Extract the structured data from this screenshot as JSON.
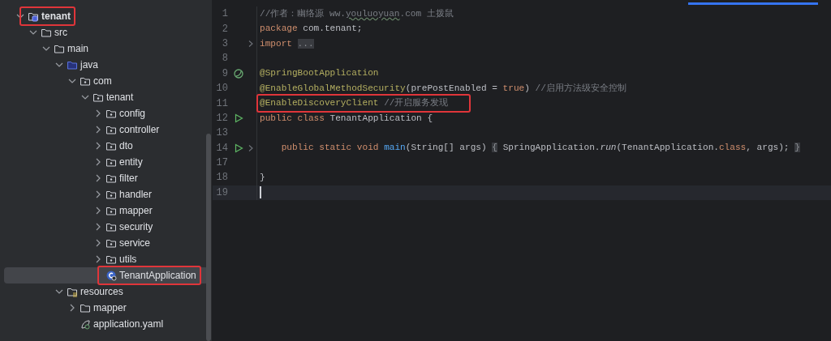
{
  "project_tree": {
    "items": [
      {
        "label": "tenant",
        "kind": "module",
        "expanded": true,
        "selected": false,
        "highlighted": true,
        "children": [
          {
            "label": "src",
            "kind": "folder",
            "expanded": true,
            "selected": false,
            "highlighted": false,
            "children": [
              {
                "label": "main",
                "kind": "folder",
                "expanded": true,
                "selected": false,
                "highlighted": false,
                "children": [
                  {
                    "label": "java",
                    "kind": "source-folder",
                    "expanded": true,
                    "selected": false,
                    "highlighted": false,
                    "children": [
                      {
                        "label": "com",
                        "kind": "package",
                        "expanded": true,
                        "selected": false,
                        "highlighted": false,
                        "children": [
                          {
                            "label": "tenant",
                            "kind": "package",
                            "expanded": true,
                            "selected": false,
                            "highlighted": false,
                            "children": [
                              {
                                "label": "config",
                                "kind": "package",
                                "expanded": false,
                                "selected": false,
                                "highlighted": false
                              },
                              {
                                "label": "controller",
                                "kind": "package",
                                "expanded": false,
                                "selected": false,
                                "highlighted": false
                              },
                              {
                                "label": "dto",
                                "kind": "package",
                                "expanded": false,
                                "selected": false,
                                "highlighted": false
                              },
                              {
                                "label": "entity",
                                "kind": "package",
                                "expanded": false,
                                "selected": false,
                                "highlighted": false
                              },
                              {
                                "label": "filter",
                                "kind": "package",
                                "expanded": false,
                                "selected": false,
                                "highlighted": false
                              },
                              {
                                "label": "handler",
                                "kind": "package",
                                "expanded": false,
                                "selected": false,
                                "highlighted": false
                              },
                              {
                                "label": "mapper",
                                "kind": "package",
                                "expanded": false,
                                "selected": false,
                                "highlighted": false
                              },
                              {
                                "label": "security",
                                "kind": "package",
                                "expanded": false,
                                "selected": false,
                                "highlighted": false
                              },
                              {
                                "label": "service",
                                "kind": "package",
                                "expanded": false,
                                "selected": false,
                                "highlighted": false
                              },
                              {
                                "label": "utils",
                                "kind": "package",
                                "expanded": false,
                                "selected": false,
                                "highlighted": false
                              },
                              {
                                "label": "TenantApplication",
                                "kind": "class",
                                "selected": true,
                                "highlighted": true
                              }
                            ]
                          }
                        ]
                      }
                    ]
                  },
                  {
                    "label": "resources",
                    "kind": "resources-folder",
                    "expanded": true,
                    "selected": false,
                    "highlighted": false,
                    "children": [
                      {
                        "label": "mapper",
                        "kind": "folder",
                        "expanded": false,
                        "selected": false,
                        "highlighted": false
                      },
                      {
                        "label": "application.yaml",
                        "kind": "yaml",
                        "selected": false,
                        "highlighted": false
                      }
                    ]
                  }
                ]
              }
            ]
          }
        ]
      }
    ]
  },
  "editor": {
    "lines": [
      {
        "number": "1",
        "kind": "plain",
        "fold": false,
        "current": false,
        "highlighted": false,
        "tokens": [
          {
            "kind": "comment",
            "text": "//作者：幽络源 ww."
          },
          {
            "kind": "typo",
            "text": "youluoyuan"
          },
          {
            "kind": "comment",
            "text": ".com 土拨鼠"
          }
        ]
      },
      {
        "number": "2",
        "kind": "plain",
        "fold": false,
        "current": false,
        "highlighted": false,
        "tokens": [
          {
            "kind": "keyword",
            "text": "package "
          },
          {
            "kind": "plain",
            "text": "com.tenant;"
          }
        ]
      },
      {
        "number": "3",
        "kind": "plain",
        "fold": true,
        "current": false,
        "highlighted": false,
        "tokens": [
          {
            "kind": "keyword",
            "text": "import "
          },
          {
            "kind": "folded",
            "text": "..."
          }
        ]
      },
      {
        "number": "8",
        "kind": "plain",
        "fold": false,
        "current": false
      },
      {
        "number": "9",
        "kind": "bean",
        "fold": false,
        "current": false,
        "highlighted": false,
        "tokens": [
          {
            "kind": "annotation",
            "text": "@SpringBootApplication"
          }
        ]
      },
      {
        "number": "10",
        "kind": "plain",
        "fold": false,
        "current": false,
        "highlighted": false,
        "tokens": [
          {
            "kind": "annotation",
            "text": "@EnableGlobalMethodSecurity"
          },
          {
            "kind": "plain",
            "text": "(prePostEnabled = "
          },
          {
            "kind": "keyword",
            "text": "true"
          },
          {
            "kind": "plain",
            "text": ") "
          },
          {
            "kind": "comment",
            "text": "//启用方法级安全控制"
          }
        ]
      },
      {
        "number": "11",
        "kind": "plain",
        "fold": false,
        "current": false,
        "highlighted": true,
        "tokens": [
          {
            "kind": "annotation",
            "text": "@EnableDiscoveryClient"
          },
          {
            "kind": "comment",
            "text": " //开启服务发现"
          }
        ]
      },
      {
        "number": "12",
        "kind": "run",
        "fold": false,
        "current": false,
        "highlighted": false,
        "tokens": [
          {
            "kind": "keyword",
            "text": "public class "
          },
          {
            "kind": "plain",
            "text": "TenantApplication {"
          }
        ]
      },
      {
        "number": "13",
        "kind": "plain",
        "fold": false,
        "current": false
      },
      {
        "number": "14",
        "kind": "run",
        "fold": true,
        "current": false,
        "highlighted": false,
        "tokens": [
          {
            "kind": "keyword",
            "text": "    public static void "
          },
          {
            "kind": "method",
            "text": "main"
          },
          {
            "kind": "plain",
            "text": "(String[] args) "
          },
          {
            "kind": "folded",
            "text": "{"
          },
          {
            "kind": "plain",
            "text": " SpringApplication."
          },
          {
            "kind": "italic",
            "text": "run"
          },
          {
            "kind": "plain",
            "text": "(TenantApplication."
          },
          {
            "kind": "keyword",
            "text": "class"
          },
          {
            "kind": "plain",
            "text": ", args); "
          },
          {
            "kind": "folded",
            "text": "}"
          }
        ]
      },
      {
        "number": "17",
        "kind": "plain",
        "fold": false,
        "current": false
      },
      {
        "number": "18",
        "kind": "plain",
        "fold": false,
        "current": false,
        "highlighted": false,
        "tokens": [
          {
            "kind": "plain",
            "text": "}"
          }
        ]
      },
      {
        "number": "19",
        "kind": "plain",
        "fold": false,
        "current": true
      }
    ]
  }
}
